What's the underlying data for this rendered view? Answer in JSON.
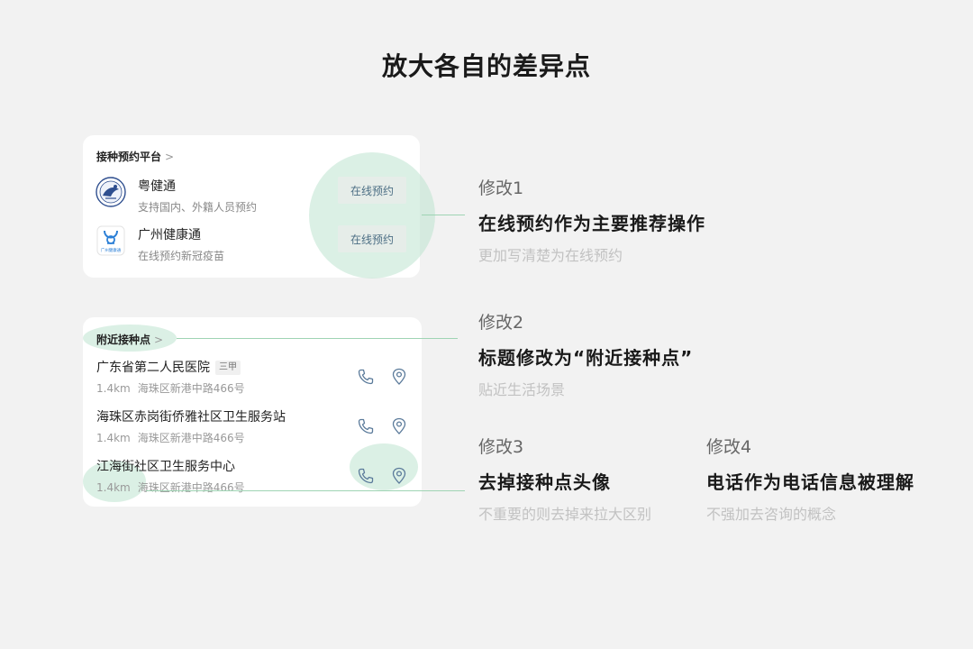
{
  "page": {
    "title": "放大各自的差异点"
  },
  "card1": {
    "header": "接种预约平台",
    "header_chevron": ">",
    "apps": [
      {
        "name": "粤健通",
        "desc": "支持国内、外籍人员预约",
        "button": "在线预约",
        "logo": "badge-logo-icon"
      },
      {
        "name": "广州健康通",
        "desc": "在线预约新冠疫苗",
        "button": "在线预约",
        "logo": "app-logo-icon",
        "logo_caption": "广州健康通"
      }
    ]
  },
  "card2": {
    "header": "附近接种点",
    "header_chevron": ">",
    "hospitals": [
      {
        "name": "广东省第二人民医院",
        "tag": "三甲",
        "distance": "1.4km",
        "address": "海珠区新港中路466号"
      },
      {
        "name": "海珠区赤岗街侨雅社区卫生服务站",
        "distance": "1.4km",
        "address": "海珠区新港中路466号"
      },
      {
        "name": "江海街社区卫生服务中心",
        "distance": "1.4km",
        "address": "海珠区新港中路466号"
      }
    ],
    "icons": {
      "phone": "phone-icon",
      "location": "location-pin-icon"
    }
  },
  "annotations": [
    {
      "label": "修改1",
      "title": "在线预约作为主要推荐操作",
      "desc": "更加写清楚为在线预约"
    },
    {
      "label": "修改2",
      "title": "标题修改为“附近接种点”",
      "desc": "贴近生活场景"
    },
    {
      "label": "修改3",
      "title": "去掉接种点头像",
      "desc": "不重要的则去掉来拉大区别"
    },
    {
      "label": "修改4",
      "title": "电话作为电话信息被理解",
      "desc": "不强加去咨询的概念"
    }
  ],
  "colors": {
    "background": "#f2f2f2",
    "card": "#ffffff",
    "highlight": "#bee4d0",
    "connector": "#9fd4b4",
    "button_bg": "#e6ede9",
    "button_text": "#4d6f85",
    "icon": "#5a7a9a"
  }
}
